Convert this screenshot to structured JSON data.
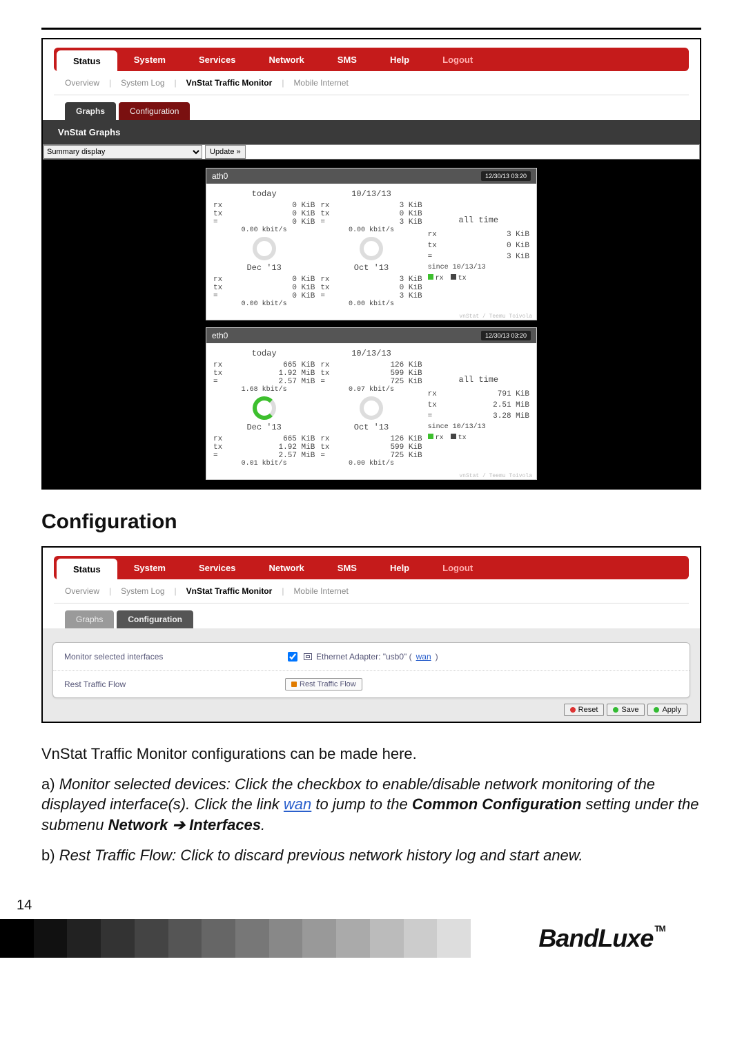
{
  "nav": {
    "main": [
      "Status",
      "System",
      "Services",
      "Network",
      "SMS",
      "Help",
      "Logout"
    ],
    "active_main": "Status",
    "sub": [
      "Overview",
      "System Log",
      "VnStat Traffic Monitor",
      "Mobile Internet"
    ],
    "active_sub": "VnStat Traffic Monitor",
    "third_graphs": [
      "Graphs",
      "Configuration"
    ],
    "third_cfg": [
      "Graphs",
      "Configuration"
    ]
  },
  "graphs_panel": {
    "title": "VnStat Graphs",
    "select_value": "Summary display",
    "update_btn": "Update »",
    "timestamp": "12/30/13 03:20",
    "vn_footer": "vnStat / Teemu Toivola",
    "legend_rx": "rx",
    "legend_tx": "tx",
    "ifaces": [
      {
        "name": "ath0",
        "periods": {
          "today": {
            "title": "today",
            "rx": "0 KiB",
            "tx": "0 KiB",
            "eq": "0 KiB",
            "rate": "0.00 kbit/s"
          },
          "date1": {
            "title": "10/13/13",
            "rx": "3 KiB",
            "tx": "0 KiB",
            "eq": "3 KiB",
            "rate": "0.00 kbit/s"
          },
          "month_a": {
            "title": "Dec '13",
            "rx": "0 KiB",
            "tx": "0 KiB",
            "eq": "0 KiB",
            "rate": "0.00 kbit/s"
          },
          "month_b": {
            "title": "Oct '13",
            "rx": "3 KiB",
            "tx": "0 KiB",
            "eq": "3 KiB",
            "rate": "0.00 kbit/s"
          }
        },
        "alltime": {
          "title": "all time",
          "rx": "3 KiB",
          "tx": "0 KiB",
          "eq": "3 KiB",
          "since": "since 10/13/13"
        }
      },
      {
        "name": "eth0",
        "periods": {
          "today": {
            "title": "today",
            "rx": "665 KiB",
            "tx": "1.92 MiB",
            "eq": "2.57 MiB",
            "rate": "1.68 kbit/s"
          },
          "date1": {
            "title": "10/13/13",
            "rx": "126 KiB",
            "tx": "599 KiB",
            "eq": "725 KiB",
            "rate": "0.07 kbit/s"
          },
          "month_a": {
            "title": "Dec '13",
            "rx": "665 KiB",
            "tx": "1.92 MiB",
            "eq": "2.57 MiB",
            "rate": "0.01 kbit/s"
          },
          "month_b": {
            "title": "Oct '13",
            "rx": "126 KiB",
            "tx": "599 KiB",
            "eq": "725 KiB",
            "rate": "0.00 kbit/s"
          }
        },
        "alltime": {
          "title": "all time",
          "rx": "791 KiB",
          "tx": "2.51 MiB",
          "eq": "3.28 MiB",
          "since": "since 10/13/13"
        }
      }
    ]
  },
  "section_heading": "Configuration",
  "cfg_panel": {
    "row_monitor_label": "Monitor selected interfaces",
    "row_monitor_text": "Ethernet Adapter: \"usb0\" (",
    "row_monitor_link": "wan",
    "row_monitor_close": ")",
    "row_rest_label": "Rest Traffic Flow",
    "row_rest_btn": "Rest Traffic Flow",
    "actions": {
      "reset": "Reset",
      "save": "Save",
      "apply": "Apply"
    }
  },
  "prose": {
    "p0": "VnStat Traffic Monitor configurations can be made here.",
    "a_lead": "a) ",
    "a_it1": "Monitor selected devices: Click the checkbox to enable/disable network monitoring of the displayed interface(s). Click the link ",
    "a_link": "wan",
    "a_it2": " to jump to the ",
    "a_b1": "Common Configuration",
    "a_it3": " setting under the submenu ",
    "a_b2": "Network ➔ Interfaces",
    "a_it4": ".",
    "b_lead": "b) ",
    "b_it": "Rest Traffic Flow: Click to discard previous network history log and start anew."
  },
  "page_num": "14",
  "logo": {
    "text": "BandLuxe",
    "tm": "TM"
  }
}
